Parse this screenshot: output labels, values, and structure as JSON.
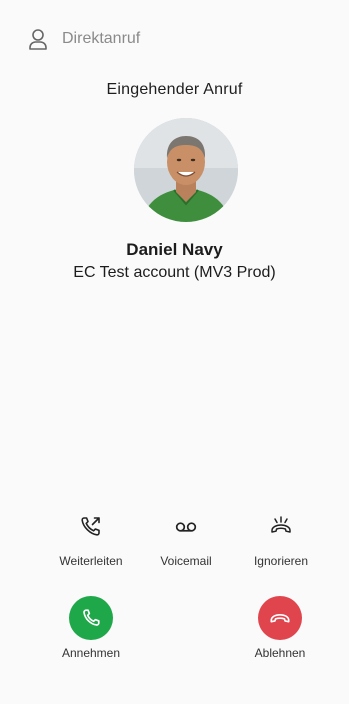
{
  "header": {
    "label": "Direktanruf",
    "icon": "user-icon"
  },
  "call": {
    "title": "Eingehender Anruf",
    "caller_name": "Daniel Navy",
    "caller_account": "EC Test account (MV3 Prod)"
  },
  "actions": [
    {
      "label": "Weiterleiten",
      "icon": "call-forward-icon"
    },
    {
      "label": "Voicemail",
      "icon": "voicemail-icon"
    },
    {
      "label": "Ignorieren",
      "icon": "ignore-icon"
    }
  ],
  "buttons": {
    "accept": {
      "label": "Annehmen",
      "color": "#1fa84a",
      "icon": "phone-icon"
    },
    "decline": {
      "label": "Ablehnen",
      "color": "#e0454e",
      "icon": "hang-up-icon"
    }
  }
}
